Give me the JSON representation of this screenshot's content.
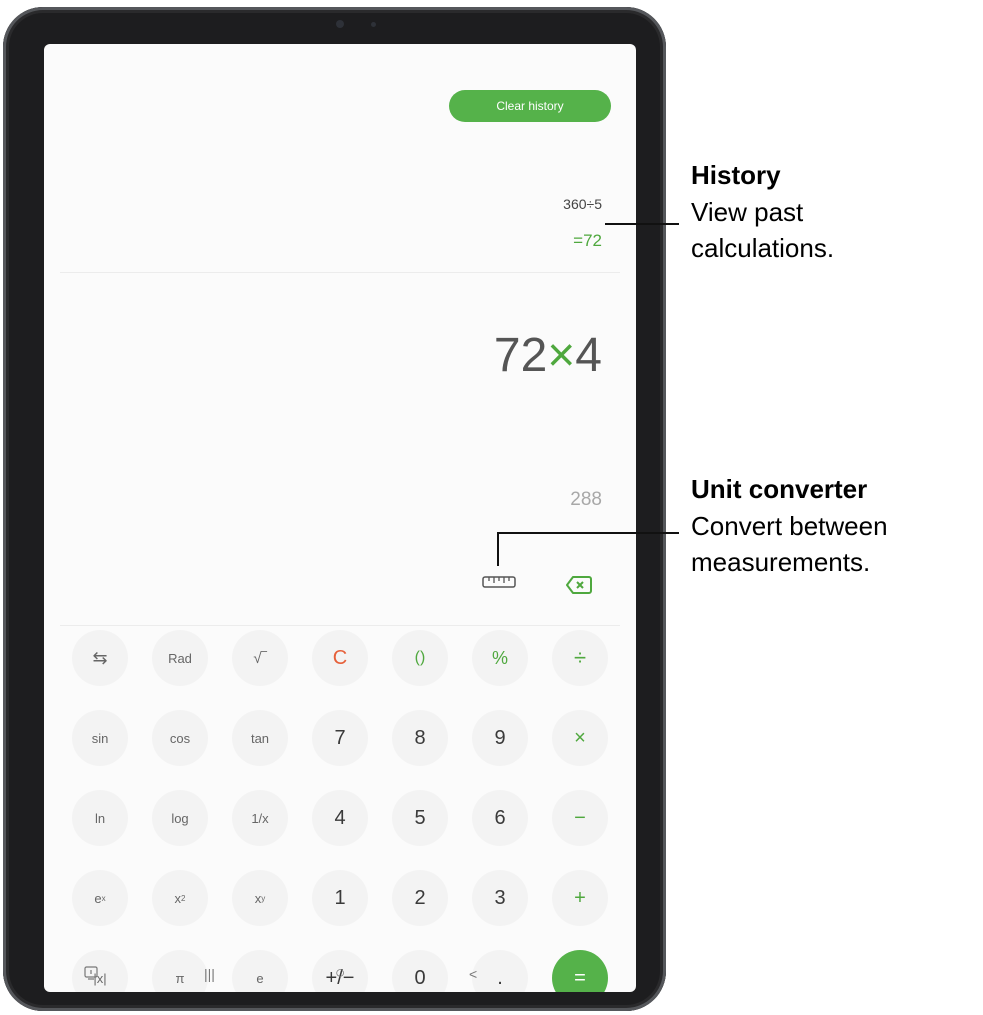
{
  "history": {
    "clear_label": "Clear history",
    "expression": "360÷5",
    "result": "=72"
  },
  "display": {
    "expression_a": "72",
    "expression_op": "×",
    "expression_b": "4",
    "preview": "288"
  },
  "keypad": {
    "row1": [
      "⇆",
      "Rad",
      "√‾",
      "C",
      "()",
      "%",
      "÷"
    ],
    "row2": [
      "sin",
      "cos",
      "tan",
      "7",
      "8",
      "9",
      "×"
    ],
    "row3": [
      "ln",
      "log",
      "1/x",
      "4",
      "5",
      "6",
      "−"
    ],
    "row4_plain": [
      "1",
      "2",
      "3",
      "+"
    ],
    "row4_sup": {
      "ex_base": "e",
      "ex_exp": "x",
      "x2_base": "x",
      "x2_exp": "2",
      "xy_base": "x",
      "xy_exp": "y"
    },
    "row5": [
      "|x|",
      "π",
      "e",
      "+/−",
      "0",
      ".",
      "="
    ]
  },
  "navbar": {
    "recents": "|||",
    "home": "○",
    "back": "<"
  },
  "icons": [
    "screenshot-icon",
    "ruler-icon",
    "backspace-icon"
  ],
  "annotations": {
    "history_title": "History",
    "history_line1": "View past",
    "history_line2": "calculations.",
    "unit_title": "Unit converter",
    "unit_line1": "Convert between",
    "unit_line2": "measurements."
  },
  "colors": {
    "accent": "#55b24a",
    "clear": "#e6603a"
  }
}
